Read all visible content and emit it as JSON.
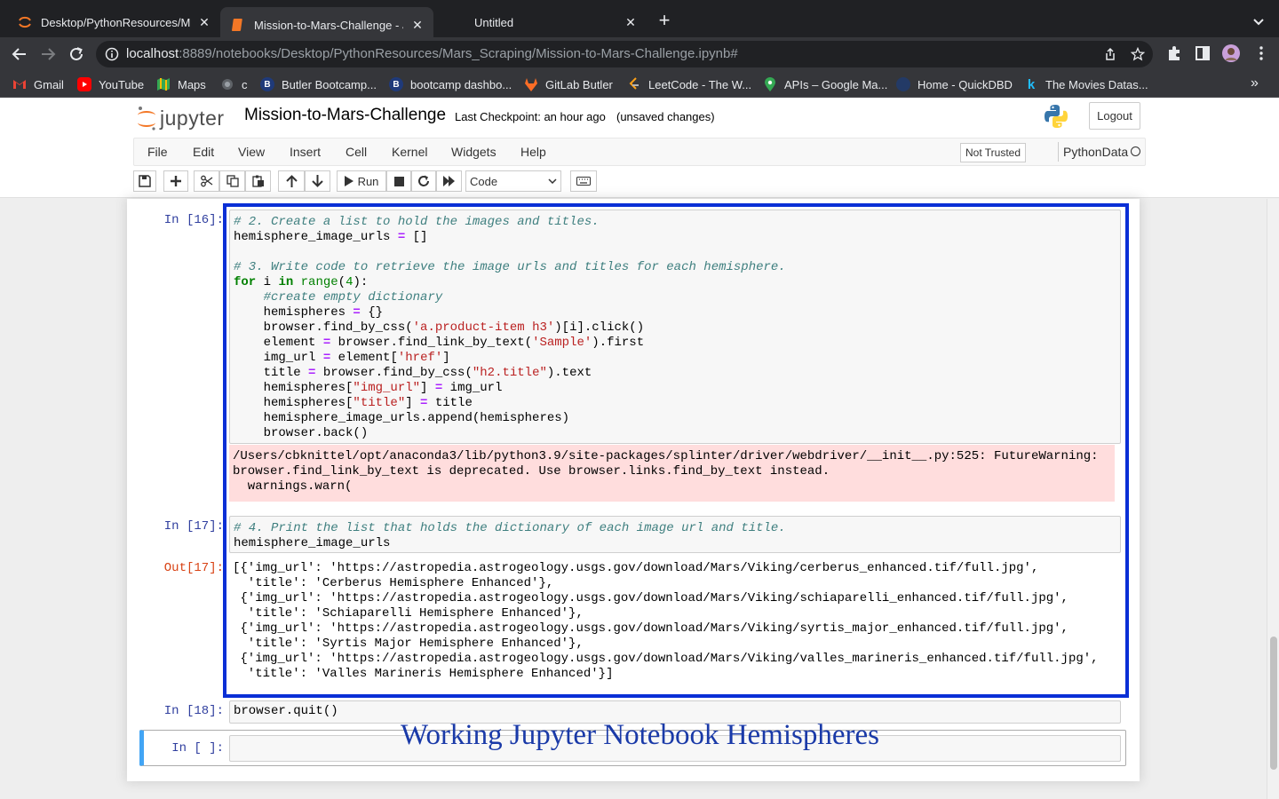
{
  "browser": {
    "tabs": [
      {
        "title": "Desktop/PythonResources/Mars",
        "active": false
      },
      {
        "title": "Mission-to-Mars-Challenge - J",
        "active": true
      },
      {
        "title": "Untitled",
        "active": false
      }
    ],
    "url_host": "localhost",
    "url_rest": ":8889/notebooks/Desktop/PythonResources/Mars_Scraping/Mission-to-Mars-Challenge.ipynb#",
    "bookmarks": [
      {
        "label": "Gmail",
        "icon": "gmail-icon"
      },
      {
        "label": "YouTube",
        "icon": "youtube-icon"
      },
      {
        "label": "Maps",
        "icon": "maps-icon"
      },
      {
        "label": "c",
        "icon": "globe-icon"
      },
      {
        "label": "Butler Bootcamp...",
        "icon": "butler-icon"
      },
      {
        "label": "bootcamp dashbo...",
        "icon": "butler-icon"
      },
      {
        "label": "GitLab Butler",
        "icon": "gitlab-icon"
      },
      {
        "label": "LeetCode - The W...",
        "icon": "leetcode-icon"
      },
      {
        "label": "APIs – Google Ma...",
        "icon": "maps-pin-icon"
      },
      {
        "label": "Home - QuickDBD",
        "icon": "quickdbd-icon"
      },
      {
        "label": "The Movies Datas...",
        "icon": "kaggle-icon"
      }
    ]
  },
  "jupyter": {
    "logo_text": "jupyter",
    "notebook_name": "Mission-to-Mars-Challenge",
    "checkpoint": "Last Checkpoint: an hour ago",
    "save_status": "(unsaved changes)",
    "logout_label": "Logout",
    "menu": [
      "File",
      "Edit",
      "View",
      "Insert",
      "Cell",
      "Kernel",
      "Widgets",
      "Help"
    ],
    "trusted": "Not Trusted",
    "kernel": "PythonData",
    "run_label": "Run",
    "cell_type": "Code"
  },
  "cells": {
    "c16": {
      "prompt": "In [16]:"
    },
    "c16_stderr": "/Users/cbknittel/opt/anaconda3/lib/python3.9/site-packages/splinter/driver/webdriver/__init__.py:525: FutureWarning:\nbrowser.find_link_by_text is deprecated. Use browser.links.find_by_text instead.\n  warnings.warn(",
    "c17": {
      "prompt": "In [17]:",
      "out_prompt": "Out[17]:"
    },
    "c17_output": "[{'img_url': 'https://astropedia.astrogeology.usgs.gov/download/Mars/Viking/cerberus_enhanced.tif/full.jpg',\n  'title': 'Cerberus Hemisphere Enhanced'},\n {'img_url': 'https://astropedia.astrogeology.usgs.gov/download/Mars/Viking/schiaparelli_enhanced.tif/full.jpg',\n  'title': 'Schiaparelli Hemisphere Enhanced'},\n {'img_url': 'https://astropedia.astrogeology.usgs.gov/download/Mars/Viking/syrtis_major_enhanced.tif/full.jpg',\n  'title': 'Syrtis Major Hemisphere Enhanced'},\n {'img_url': 'https://astropedia.astrogeology.usgs.gov/download/Mars/Viking/valles_marineris_enhanced.tif/full.jpg',\n  'title': 'Valles Marineris Hemisphere Enhanced'}]",
    "c18": {
      "prompt": "In [18]:",
      "code": "browser.quit()"
    },
    "empty": {
      "prompt": "In [ ]:"
    }
  },
  "code16": [
    [
      [
        "c",
        "# 2. Create a list to hold the images and titles."
      ]
    ],
    [
      [
        "t",
        "hemisphere_image_urls "
      ],
      [
        "o",
        "="
      ],
      [
        "t",
        " []"
      ]
    ],
    [
      [
        "t",
        ""
      ]
    ],
    [
      [
        "c",
        "# 3. Write code to retrieve the image urls and titles for each hemisphere."
      ]
    ],
    [
      [
        "k",
        "for"
      ],
      [
        "t",
        " i "
      ],
      [
        "k",
        "in"
      ],
      [
        "t",
        " "
      ],
      [
        "b",
        "range"
      ],
      [
        "t",
        "("
      ],
      [
        "n",
        "4"
      ],
      [
        "t",
        "):"
      ]
    ],
    [
      [
        "t",
        "    "
      ],
      [
        "c",
        "#create empty dictionary"
      ]
    ],
    [
      [
        "t",
        "    hemispheres "
      ],
      [
        "o",
        "="
      ],
      [
        "t",
        " {}"
      ]
    ],
    [
      [
        "t",
        "    browser.find_by_css("
      ],
      [
        "s",
        "'a.product-item h3'"
      ],
      [
        "t",
        ")[i].click()"
      ]
    ],
    [
      [
        "t",
        "    element "
      ],
      [
        "o",
        "="
      ],
      [
        "t",
        " browser.find_link_by_text("
      ],
      [
        "s",
        "'Sample'"
      ],
      [
        "t",
        ").first"
      ]
    ],
    [
      [
        "t",
        "    img_url "
      ],
      [
        "o",
        "="
      ],
      [
        "t",
        " element["
      ],
      [
        "s",
        "'href'"
      ],
      [
        "t",
        "]"
      ]
    ],
    [
      [
        "t",
        "    title "
      ],
      [
        "o",
        "="
      ],
      [
        "t",
        " browser.find_by_css("
      ],
      [
        "s",
        "\"h2.title\""
      ],
      [
        "t",
        ").text"
      ]
    ],
    [
      [
        "t",
        "    hemispheres["
      ],
      [
        "s",
        "\"img_url\""
      ],
      [
        "t",
        "] "
      ],
      [
        "o",
        "="
      ],
      [
        "t",
        " img_url"
      ]
    ],
    [
      [
        "t",
        "    hemispheres["
      ],
      [
        "s",
        "\"title\""
      ],
      [
        "t",
        "] "
      ],
      [
        "o",
        "="
      ],
      [
        "t",
        " title"
      ]
    ],
    [
      [
        "t",
        "    hemisphere_image_urls.append(hemispheres)"
      ]
    ],
    [
      [
        "t",
        "    browser.back()"
      ]
    ]
  ],
  "code17": [
    [
      [
        "c",
        "# 4. Print the list that holds the dictionary of each image url and title."
      ]
    ],
    [
      [
        "t",
        "hemisphere_image_urls"
      ]
    ]
  ],
  "overlay_caption": "Working Jupyter Notebook Hemispheres"
}
